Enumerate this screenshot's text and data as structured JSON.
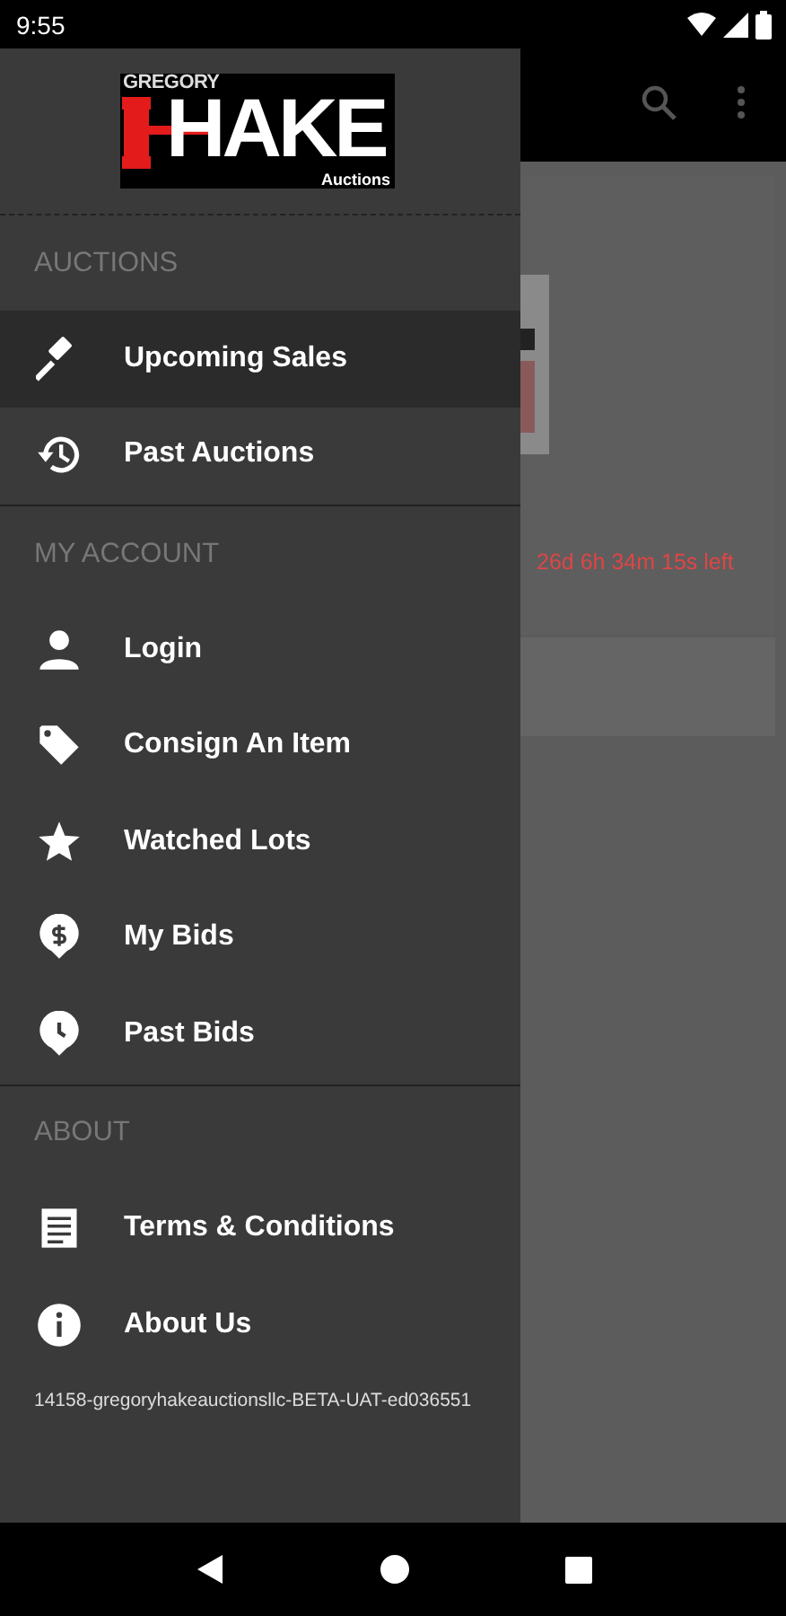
{
  "status_bar": {
    "time": "9:55"
  },
  "background": {
    "countdown": "26d 6h 34m 15s left"
  },
  "drawer": {
    "logo": {
      "top": "GREGORY",
      "main": "HAKE",
      "bottom": "Auctions"
    },
    "sections": [
      {
        "title": "AUCTIONS",
        "items": [
          {
            "label": "Upcoming Sales",
            "selected": true
          },
          {
            "label": "Past Auctions",
            "selected": false
          }
        ]
      },
      {
        "title": "MY ACCOUNT",
        "items": [
          {
            "label": "Login",
            "selected": false
          },
          {
            "label": "Consign An Item",
            "selected": false
          },
          {
            "label": "Watched Lots",
            "selected": false
          },
          {
            "label": "My Bids",
            "selected": false
          },
          {
            "label": "Past Bids",
            "selected": false
          }
        ]
      },
      {
        "title": "ABOUT",
        "items": [
          {
            "label": "Terms & Conditions",
            "selected": false
          },
          {
            "label": "About Us",
            "selected": false
          }
        ]
      }
    ],
    "version": "14158-gregoryhakeauctionsllc-BETA-UAT-ed036551"
  }
}
